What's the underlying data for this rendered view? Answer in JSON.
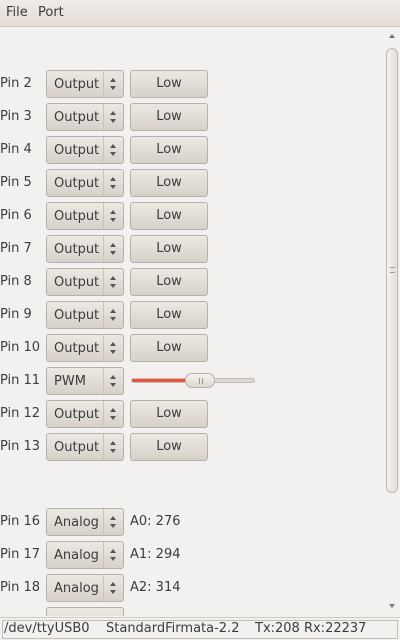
{
  "menubar": {
    "file_label": "File",
    "port_label": "Port"
  },
  "pins": [
    {
      "label": "Pin 2",
      "mode": "Output",
      "button": "Low"
    },
    {
      "label": "Pin 3",
      "mode": "Output",
      "button": "Low"
    },
    {
      "label": "Pin 4",
      "mode": "Output",
      "button": "Low"
    },
    {
      "label": "Pin 5",
      "mode": "Output",
      "button": "Low"
    },
    {
      "label": "Pin 6",
      "mode": "Output",
      "button": "Low"
    },
    {
      "label": "Pin 7",
      "mode": "Output",
      "button": "Low"
    },
    {
      "label": "Pin 8",
      "mode": "Output",
      "button": "Low"
    },
    {
      "label": "Pin 9",
      "mode": "Output",
      "button": "Low"
    },
    {
      "label": "Pin 10",
      "mode": "Output",
      "button": "Low"
    },
    {
      "label": "Pin 11",
      "mode": "PWM",
      "pwm_level": 0.55
    },
    {
      "label": "Pin 12",
      "mode": "Output",
      "button": "Low"
    },
    {
      "label": "Pin 13",
      "mode": "Output",
      "button": "Low"
    }
  ],
  "analog_pins": [
    {
      "label": "Pin 16",
      "mode": "Analog",
      "reading": "A0: 276"
    },
    {
      "label": "Pin 17",
      "mode": "Analog",
      "reading": "A1: 294"
    },
    {
      "label": "Pin 18",
      "mode": "Analog",
      "reading": "A2: 314"
    }
  ],
  "status": {
    "port": "/dev/ttyUSB0",
    "firmware": "StandardFirmata-2.2",
    "traffic": "Tx:208 Rx:22237"
  },
  "colors": {
    "pwm_fill": "#e8523e",
    "background": "#f2f1f0"
  }
}
